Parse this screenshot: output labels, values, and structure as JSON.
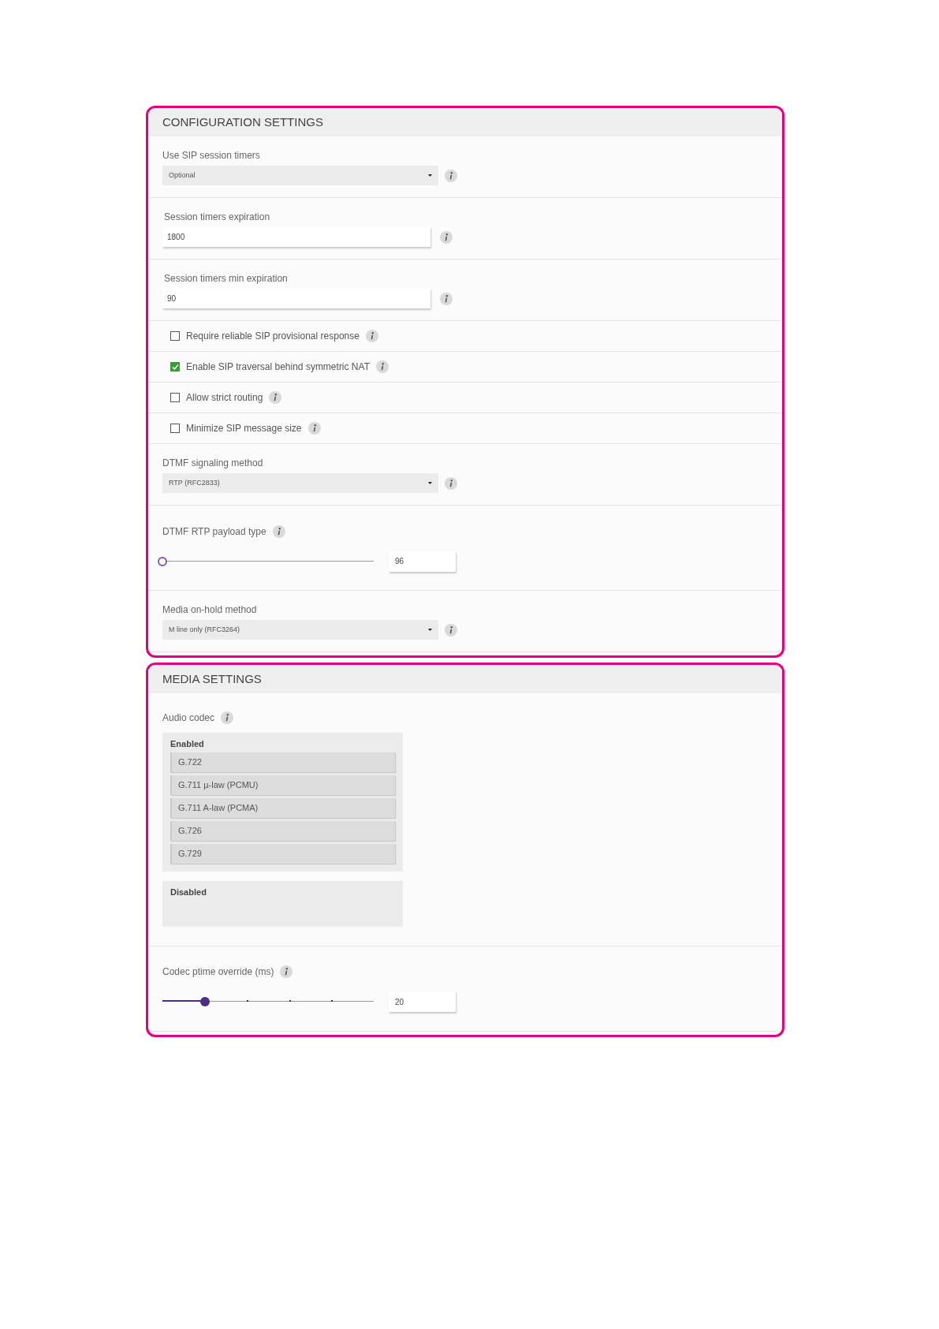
{
  "panels": [
    {
      "title": "CONFIGURATION SETTINGS",
      "rows": [
        {
          "kind": "select",
          "label": "Use SIP session timers",
          "value": "Optional"
        },
        {
          "kind": "text",
          "label": "Session timers expiration",
          "value": "1800"
        },
        {
          "kind": "text",
          "label": "Session timers min expiration",
          "value": "90"
        },
        {
          "kind": "checkbox",
          "label": "Require reliable SIP provisional response",
          "checked": false
        },
        {
          "kind": "checkbox",
          "label": "Enable SIP traversal behind symmetric NAT",
          "checked": true
        },
        {
          "kind": "checkbox",
          "label": "Allow strict routing",
          "checked": false
        },
        {
          "kind": "checkbox",
          "label": "Minimize SIP message size",
          "checked": false
        },
        {
          "kind": "select",
          "label": "DTMF signaling method",
          "value": "RTP (RFC2833)"
        },
        {
          "kind": "slider",
          "label": "DTMF RTP payload type",
          "level": 0,
          "stepped": false,
          "value": "96"
        },
        {
          "kind": "select",
          "label": "Media on-hold method",
          "value": "M line only (RFC3264)"
        }
      ]
    },
    {
      "title": "MEDIA SETTINGS",
      "rows": [
        {
          "kind": "codecs",
          "label": "Audio codec",
          "groups": [
            {
              "title": "Enabled",
              "items": [
                "G.722",
                "G.711 µ-law (PCMU)",
                "G.711 A-law (PCMA)",
                "G.726",
                "G.729"
              ]
            },
            {
              "title": "Disabled"
            }
          ]
        },
        {
          "kind": "slider",
          "label": "Codec ptime override (ms)",
          "level": 0.2,
          "stepped": true,
          "value": "20"
        }
      ]
    }
  ]
}
